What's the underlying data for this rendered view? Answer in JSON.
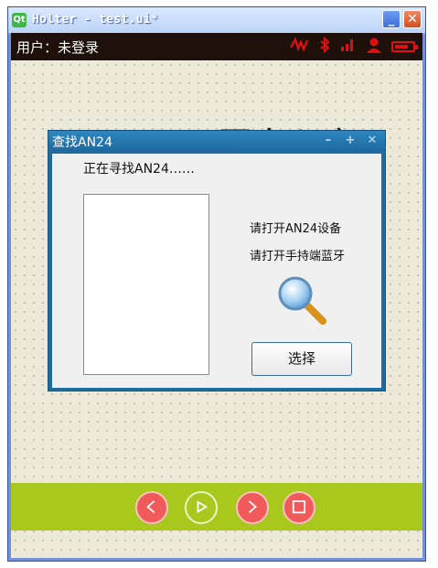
{
  "window": {
    "title": "Holter - test.ui*",
    "app_icon": "Qt"
  },
  "userbar": {
    "user_label": "用户：未登录",
    "icons": [
      "heart-rate-icon",
      "bluetooth-icon",
      "signal-icon",
      "user-icon",
      "battery-icon"
    ],
    "battery_level": 0.8,
    "status_color": "#e01010"
  },
  "background": {
    "title": "图文心率"
  },
  "dialog": {
    "title": "查找AN24",
    "searching": "正在寻找AN24……",
    "prompt_open_device": "请打开AN24设备",
    "prompt_open_bluetooth": "请打开手持端蓝牙",
    "select_label": "选择",
    "controls": [
      "minimize-icon",
      "maximize-icon",
      "close-icon"
    ]
  },
  "bottombar": {
    "color": "#a9c81e",
    "buttons": [
      "previous",
      "play",
      "next",
      "stop"
    ]
  }
}
